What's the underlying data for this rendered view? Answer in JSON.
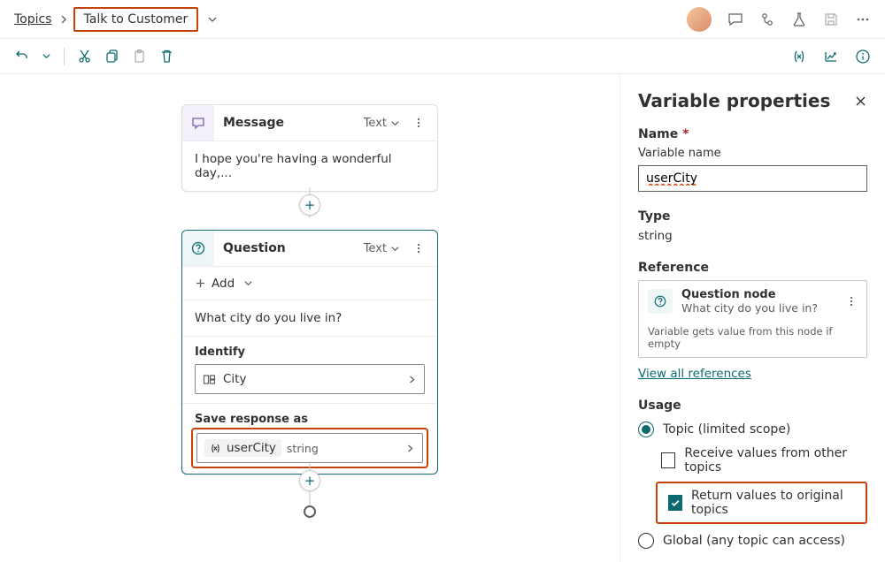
{
  "breadcrumb": {
    "root": "Topics",
    "topic": "Talk to Customer"
  },
  "toolbar": {},
  "nodes": {
    "message": {
      "title": "Message",
      "type": "Text",
      "body": "I hope you're having a wonderful day,..."
    },
    "question": {
      "title": "Question",
      "type": "Text",
      "add_label": "Add",
      "prompt": "What city do you live in?",
      "identify_label": "Identify",
      "identify_value": "City",
      "save_label": "Save response as",
      "var_name": "userCity",
      "var_type": "string"
    }
  },
  "panel": {
    "title": "Variable properties",
    "name_label": "Name",
    "name_sublabel": "Variable name",
    "name_value": "userCity",
    "type_label": "Type",
    "type_value": "string",
    "reference_label": "Reference",
    "ref_title": "Question node",
    "ref_sub": "What city do you live in?",
    "ref_foot": "Variable gets value from this node if empty",
    "view_all": "View all references",
    "usage_label": "Usage",
    "usage": {
      "topic": "Topic (limited scope)",
      "receive": "Receive values from other topics",
      "return": "Return values to original topics",
      "global": "Global (any topic can access)"
    }
  }
}
